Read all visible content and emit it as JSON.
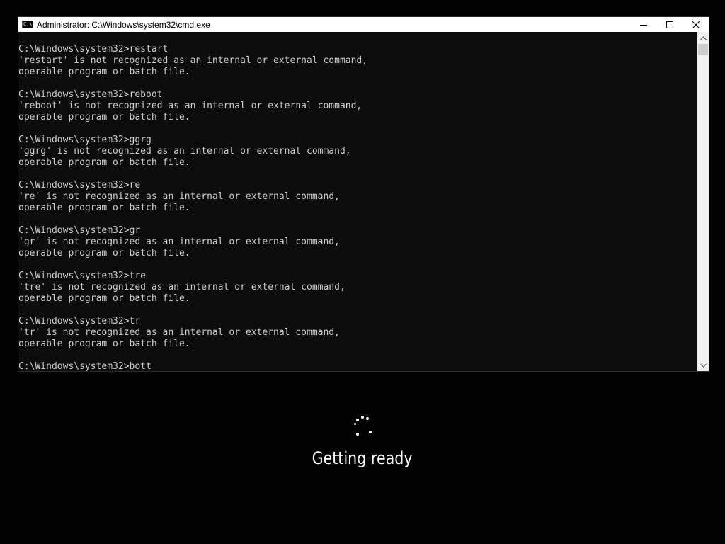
{
  "window": {
    "title": "Administrator: C:\\Windows\\system32\\cmd.exe",
    "app_icon_text": "C:\\"
  },
  "console": {
    "lines": [
      "C:\\Windows\\system32>restart",
      "'restart' is not recognized as an internal or external command,",
      "operable program or batch file.",
      "",
      "C:\\Windows\\system32>reboot",
      "'reboot' is not recognized as an internal or external command,",
      "operable program or batch file.",
      "",
      "C:\\Windows\\system32>ggrg",
      "'ggrg' is not recognized as an internal or external command,",
      "operable program or batch file.",
      "",
      "C:\\Windows\\system32>re",
      "'re' is not recognized as an internal or external command,",
      "operable program or batch file.",
      "",
      "C:\\Windows\\system32>gr",
      "'gr' is not recognized as an internal or external command,",
      "operable program or batch file.",
      "",
      "C:\\Windows\\system32>tre",
      "'tre' is not recognized as an internal or external command,",
      "operable program or batch file.",
      "",
      "C:\\Windows\\system32>tr",
      "'tr' is not recognized as an internal or external command,",
      "operable program or batch file.",
      "",
      "C:\\Windows\\system32>bott"
    ]
  },
  "status": {
    "text": "Getting ready"
  },
  "colors": {
    "background": "#000000",
    "console_background": "#0c0c0c",
    "console_text": "#cccccc",
    "titlebar": "#ffffff",
    "status_text": "#ffffff"
  }
}
